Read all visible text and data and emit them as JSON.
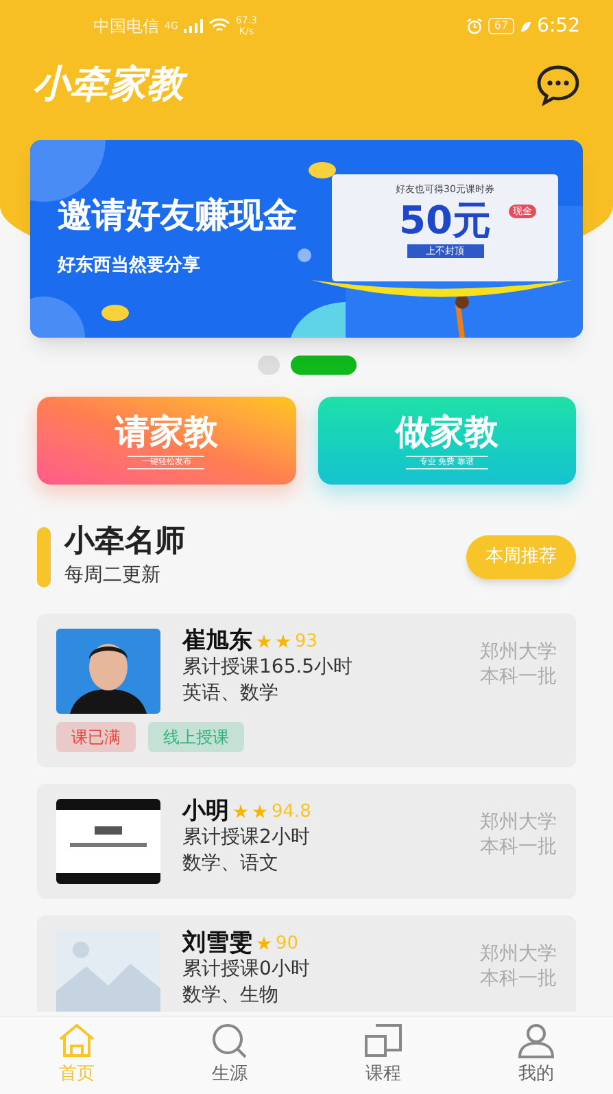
{
  "status_bar": {
    "carrier": "中国电信",
    "network": "4G",
    "speed": "67.3\nK/s",
    "battery": "67",
    "time": "6:52"
  },
  "header": {
    "title": "小牵家教"
  },
  "banner": {
    "title": "邀请好友赚现金",
    "subtitle": "好东西当然要分享",
    "coupon_header": "好友也可得30元课时券",
    "amount": "50元",
    "badge": "现金",
    "cap": "上不封顶"
  },
  "carousel_dots": [
    {
      "selected": false
    },
    {
      "selected": true
    }
  ],
  "actions": [
    {
      "label": "请家教",
      "tagline": "一键轻松发布",
      "kind": "warm"
    },
    {
      "label": "做家教",
      "tagline": "专业 免费 靠谱",
      "kind": "cool"
    }
  ],
  "section": {
    "title": "小牵名师",
    "subtitle": "每周二更新",
    "button": "本周推荐"
  },
  "teachers": [
    {
      "name": "崔旭东",
      "icons": [
        {
          "kind": "star"
        },
        {
          "kind": "star"
        }
      ],
      "score": "93",
      "hours": "累计授课165.5小时",
      "subjects": "英语、数学",
      "school": "郑州大学",
      "tier": "本科一批",
      "tags": [
        {
          "label": "课已满",
          "color": "#e8453c"
        },
        {
          "label": "线上授课",
          "color": "#2fb67c"
        }
      ]
    },
    {
      "name": "小明",
      "icons": [
        {
          "kind": "star"
        },
        {
          "kind": "star"
        }
      ],
      "score": "94.8",
      "hours": "累计授课2小时",
      "subjects": "数学、语文",
      "school": "郑州大学",
      "tier": "本科一批"
    },
    {
      "name": "刘雪雯",
      "icons": [
        {
          "kind": "star"
        }
      ],
      "score": "90",
      "hours": "累计授课0小时",
      "subjects": "数学、生物",
      "school": "郑州大学",
      "tier": "本科一批"
    }
  ],
  "tab_bar": [
    {
      "label": "首页",
      "selected": true
    },
    {
      "label": "生源",
      "selected": false
    },
    {
      "label": "课程",
      "selected": false
    },
    {
      "label": "我的",
      "selected": false
    }
  ]
}
